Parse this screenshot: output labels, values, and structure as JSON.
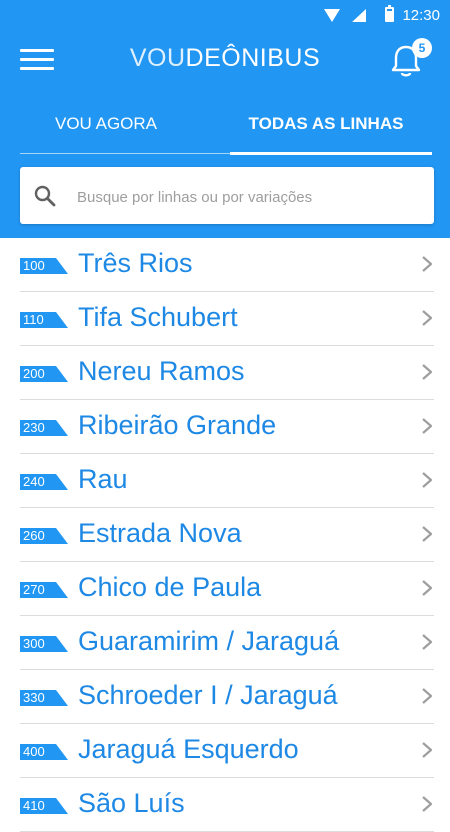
{
  "status_bar": {
    "time": "12:30"
  },
  "app_bar": {
    "logo": {
      "part1": "VOU",
      "part2": "DEÔNIBUS"
    },
    "notification_count": "5"
  },
  "tabs": [
    {
      "label": "VOU AGORA",
      "active": false
    },
    {
      "label": "TODAS AS LINHAS",
      "active": true
    }
  ],
  "search": {
    "placeholder": "Busque por linhas ou por variações",
    "value": ""
  },
  "lines": [
    {
      "number": "100",
      "name": "Três Rios"
    },
    {
      "number": "110",
      "name": "Tifa Schubert"
    },
    {
      "number": "200",
      "name": "Nereu Ramos"
    },
    {
      "number": "230",
      "name": "Ribeirão Grande"
    },
    {
      "number": "240",
      "name": "Rau"
    },
    {
      "number": "260",
      "name": "Estrada Nova"
    },
    {
      "number": "270",
      "name": "Chico de Paula"
    },
    {
      "number": "300",
      "name": "Guaramirim / Jaraguá"
    },
    {
      "number": "330",
      "name": "Schroeder I / Jaraguá"
    },
    {
      "number": "400",
      "name": "Jaraguá Esquerdo"
    },
    {
      "number": "410",
      "name": "São Luís"
    }
  ],
  "colors": {
    "primary": "#2196f3",
    "line_name": "#1e88e5",
    "background": "#ffffff"
  }
}
